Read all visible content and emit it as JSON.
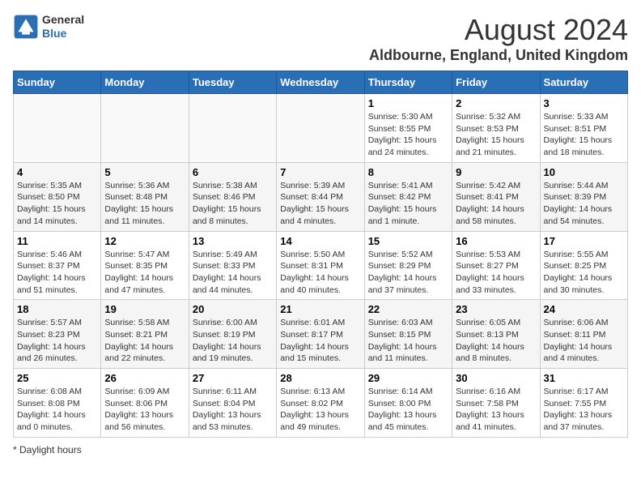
{
  "header": {
    "logo_line1": "General",
    "logo_line2": "Blue",
    "main_title": "August 2024",
    "subtitle": "Aldbourne, England, United Kingdom"
  },
  "calendar": {
    "days_of_week": [
      "Sunday",
      "Monday",
      "Tuesday",
      "Wednesday",
      "Thursday",
      "Friday",
      "Saturday"
    ],
    "weeks": [
      [
        {
          "day": "",
          "info": "",
          "empty": true
        },
        {
          "day": "",
          "info": "",
          "empty": true
        },
        {
          "day": "",
          "info": "",
          "empty": true
        },
        {
          "day": "",
          "info": "",
          "empty": true
        },
        {
          "day": "1",
          "info": "Sunrise: 5:30 AM\nSunset: 8:55 PM\nDaylight: 15 hours\nand 24 minutes."
        },
        {
          "day": "2",
          "info": "Sunrise: 5:32 AM\nSunset: 8:53 PM\nDaylight: 15 hours\nand 21 minutes."
        },
        {
          "day": "3",
          "info": "Sunrise: 5:33 AM\nSunset: 8:51 PM\nDaylight: 15 hours\nand 18 minutes."
        }
      ],
      [
        {
          "day": "4",
          "info": "Sunrise: 5:35 AM\nSunset: 8:50 PM\nDaylight: 15 hours\nand 14 minutes."
        },
        {
          "day": "5",
          "info": "Sunrise: 5:36 AM\nSunset: 8:48 PM\nDaylight: 15 hours\nand 11 minutes."
        },
        {
          "day": "6",
          "info": "Sunrise: 5:38 AM\nSunset: 8:46 PM\nDaylight: 15 hours\nand 8 minutes."
        },
        {
          "day": "7",
          "info": "Sunrise: 5:39 AM\nSunset: 8:44 PM\nDaylight: 15 hours\nand 4 minutes."
        },
        {
          "day": "8",
          "info": "Sunrise: 5:41 AM\nSunset: 8:42 PM\nDaylight: 15 hours\nand 1 minute."
        },
        {
          "day": "9",
          "info": "Sunrise: 5:42 AM\nSunset: 8:41 PM\nDaylight: 14 hours\nand 58 minutes."
        },
        {
          "day": "10",
          "info": "Sunrise: 5:44 AM\nSunset: 8:39 PM\nDaylight: 14 hours\nand 54 minutes."
        }
      ],
      [
        {
          "day": "11",
          "info": "Sunrise: 5:46 AM\nSunset: 8:37 PM\nDaylight: 14 hours\nand 51 minutes."
        },
        {
          "day": "12",
          "info": "Sunrise: 5:47 AM\nSunset: 8:35 PM\nDaylight: 14 hours\nand 47 minutes."
        },
        {
          "day": "13",
          "info": "Sunrise: 5:49 AM\nSunset: 8:33 PM\nDaylight: 14 hours\nand 44 minutes."
        },
        {
          "day": "14",
          "info": "Sunrise: 5:50 AM\nSunset: 8:31 PM\nDaylight: 14 hours\nand 40 minutes."
        },
        {
          "day": "15",
          "info": "Sunrise: 5:52 AM\nSunset: 8:29 PM\nDaylight: 14 hours\nand 37 minutes."
        },
        {
          "day": "16",
          "info": "Sunrise: 5:53 AM\nSunset: 8:27 PM\nDaylight: 14 hours\nand 33 minutes."
        },
        {
          "day": "17",
          "info": "Sunrise: 5:55 AM\nSunset: 8:25 PM\nDaylight: 14 hours\nand 30 minutes."
        }
      ],
      [
        {
          "day": "18",
          "info": "Sunrise: 5:57 AM\nSunset: 8:23 PM\nDaylight: 14 hours\nand 26 minutes."
        },
        {
          "day": "19",
          "info": "Sunrise: 5:58 AM\nSunset: 8:21 PM\nDaylight: 14 hours\nand 22 minutes."
        },
        {
          "day": "20",
          "info": "Sunrise: 6:00 AM\nSunset: 8:19 PM\nDaylight: 14 hours\nand 19 minutes."
        },
        {
          "day": "21",
          "info": "Sunrise: 6:01 AM\nSunset: 8:17 PM\nDaylight: 14 hours\nand 15 minutes."
        },
        {
          "day": "22",
          "info": "Sunrise: 6:03 AM\nSunset: 8:15 PM\nDaylight: 14 hours\nand 11 minutes."
        },
        {
          "day": "23",
          "info": "Sunrise: 6:05 AM\nSunset: 8:13 PM\nDaylight: 14 hours\nand 8 minutes."
        },
        {
          "day": "24",
          "info": "Sunrise: 6:06 AM\nSunset: 8:11 PM\nDaylight: 14 hours\nand 4 minutes."
        }
      ],
      [
        {
          "day": "25",
          "info": "Sunrise: 6:08 AM\nSunset: 8:08 PM\nDaylight: 14 hours\nand 0 minutes."
        },
        {
          "day": "26",
          "info": "Sunrise: 6:09 AM\nSunset: 8:06 PM\nDaylight: 13 hours\nand 56 minutes."
        },
        {
          "day": "27",
          "info": "Sunrise: 6:11 AM\nSunset: 8:04 PM\nDaylight: 13 hours\nand 53 minutes."
        },
        {
          "day": "28",
          "info": "Sunrise: 6:13 AM\nSunset: 8:02 PM\nDaylight: 13 hours\nand 49 minutes."
        },
        {
          "day": "29",
          "info": "Sunrise: 6:14 AM\nSunset: 8:00 PM\nDaylight: 13 hours\nand 45 minutes."
        },
        {
          "day": "30",
          "info": "Sunrise: 6:16 AM\nSunset: 7:58 PM\nDaylight: 13 hours\nand 41 minutes."
        },
        {
          "day": "31",
          "info": "Sunrise: 6:17 AM\nSunset: 7:55 PM\nDaylight: 13 hours\nand 37 minutes."
        }
      ]
    ]
  },
  "footer": {
    "note": "Daylight hours"
  }
}
